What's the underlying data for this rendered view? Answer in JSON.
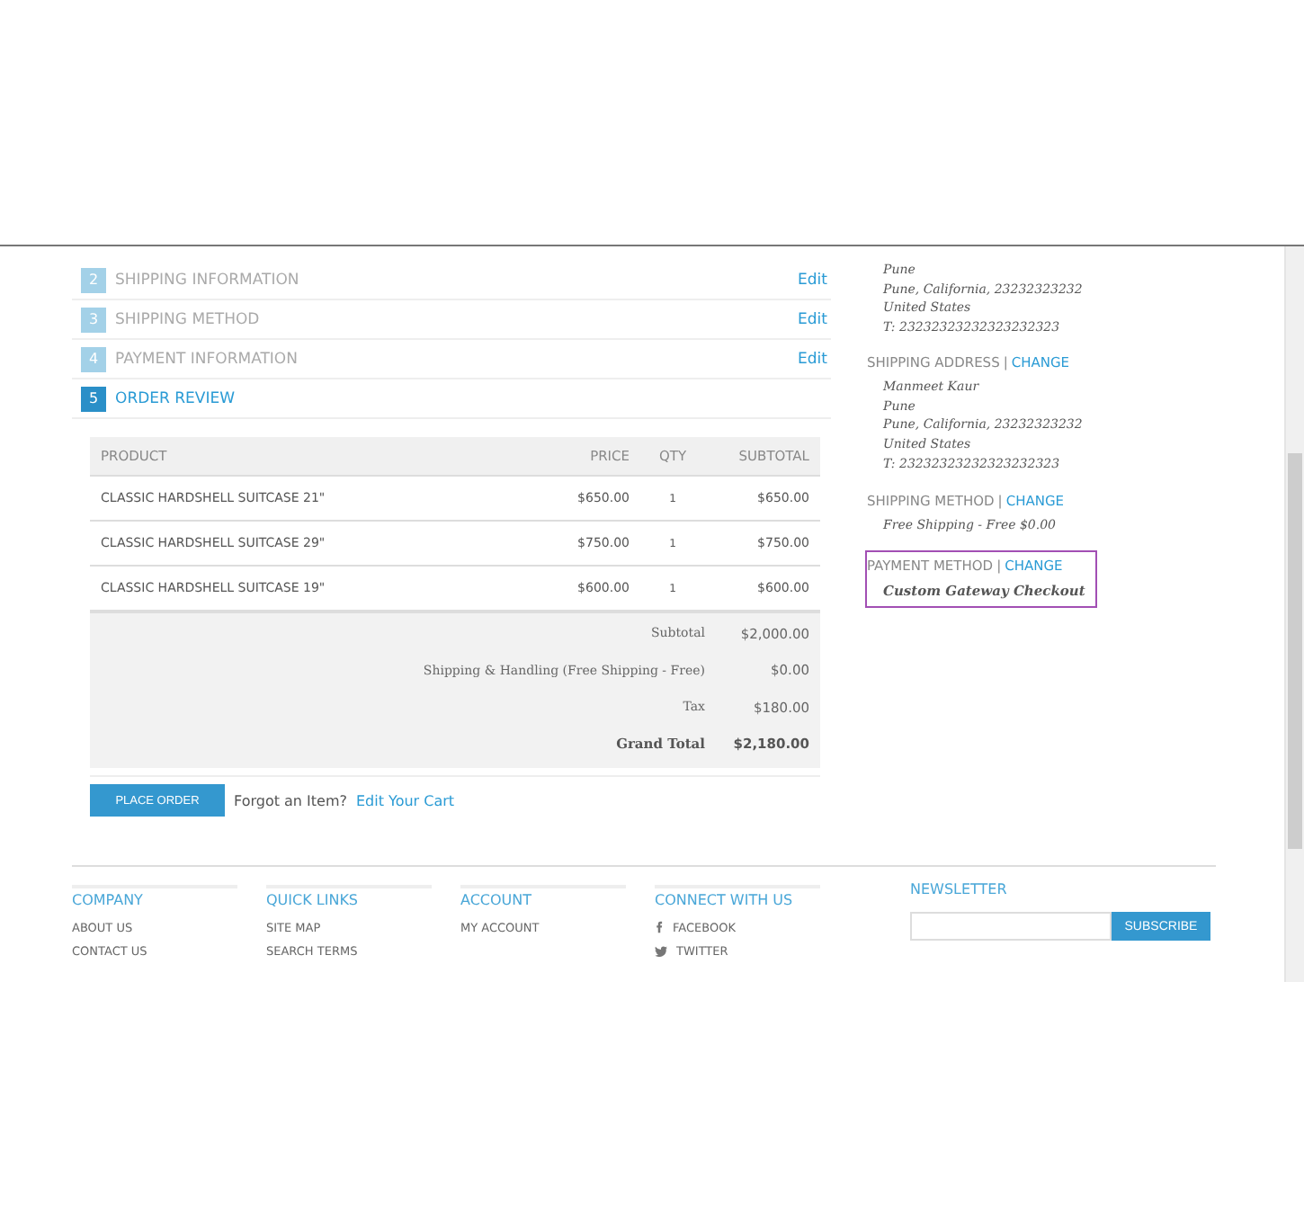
{
  "steps": [
    {
      "number": "2",
      "label": "SHIPPING INFORMATION",
      "selected": false,
      "action": "Edit"
    },
    {
      "number": "3",
      "label": "SHIPPING METHOD",
      "selected": false,
      "action": "Edit"
    },
    {
      "number": "4",
      "label": "PAYMENT INFORMATION",
      "selected": false,
      "action": "Edit"
    },
    {
      "number": "5",
      "label": "ORDER REVIEW",
      "selected": true
    }
  ],
  "table": {
    "columns": [
      "PRODUCT",
      "PRICE",
      "QTY",
      "SUBTOTAL"
    ],
    "rows": [
      [
        "CLASSIC HARDSHELL SUITCASE 21\"",
        "$650.00",
        "1",
        "$650.00"
      ],
      [
        "CLASSIC HARDSHELL SUITCASE 29\"",
        "$750.00",
        "1",
        "$750.00"
      ],
      [
        "CLASSIC HARDSHELL SUITCASE 19\"",
        "$600.00",
        "1",
        "$600.00"
      ]
    ],
    "totals": [
      {
        "kind": "normal",
        "label": "Subtotal",
        "value": "$2,000.00"
      },
      {
        "kind": "normal",
        "label": "Shipping & Handling (Free Shipping - Free)",
        "value": "$0.00"
      },
      {
        "kind": "normal",
        "label": "Tax",
        "value": "$180.00"
      },
      {
        "kind": "grand",
        "label": "Grand Total",
        "value": "$2,180.00"
      }
    ]
  },
  "place_order": {
    "button": "PLACE ORDER",
    "prompt": "Forgot an Item?",
    "link": "Edit Your Cart"
  },
  "sidebar": {
    "billing_lines": [
      "Pune",
      "Pune, California, 23232323232",
      "United States",
      "T: 23232323232323232323"
    ],
    "sections": [
      {
        "heading": "SHIPPING ADDRESS",
        "separator": "|",
        "action": "CHANGE",
        "kind": "lines",
        "lines": [
          "Manmeet Kaur",
          "Pune",
          "Pune, California, 23232323232",
          "United States",
          "T: 23232323232323232323"
        ]
      },
      {
        "heading": "SHIPPING METHOD",
        "separator": "|",
        "action": "CHANGE",
        "kind": "lines",
        "lines": [
          "Free Shipping - Free $0.00"
        ]
      },
      {
        "heading": "PAYMENT METHOD",
        "separator": "|",
        "action": "CHANGE",
        "highlighted": true,
        "kind": "strong",
        "lines": [
          "Custom Gateway Checkout"
        ]
      }
    ]
  },
  "footer": {
    "columns": [
      {
        "title": "COMPANY",
        "links": [
          {
            "label": "ABOUT US"
          },
          {
            "label": "CONTACT US"
          }
        ]
      },
      {
        "title": "QUICK LINKS",
        "links": [
          {
            "label": "SITE MAP"
          },
          {
            "label": "SEARCH TERMS"
          }
        ]
      },
      {
        "title": "ACCOUNT",
        "links": [
          {
            "label": "MY ACCOUNT"
          }
        ]
      },
      {
        "title": "CONNECT WITH US",
        "links": [
          {
            "label": "FACEBOOK",
            "kind": "f"
          },
          {
            "label": "TWITTER",
            "kind": "bird"
          }
        ]
      }
    ],
    "newsletter": {
      "title": "NEWSLETTER",
      "button": "SUBSCRIBE"
    }
  }
}
